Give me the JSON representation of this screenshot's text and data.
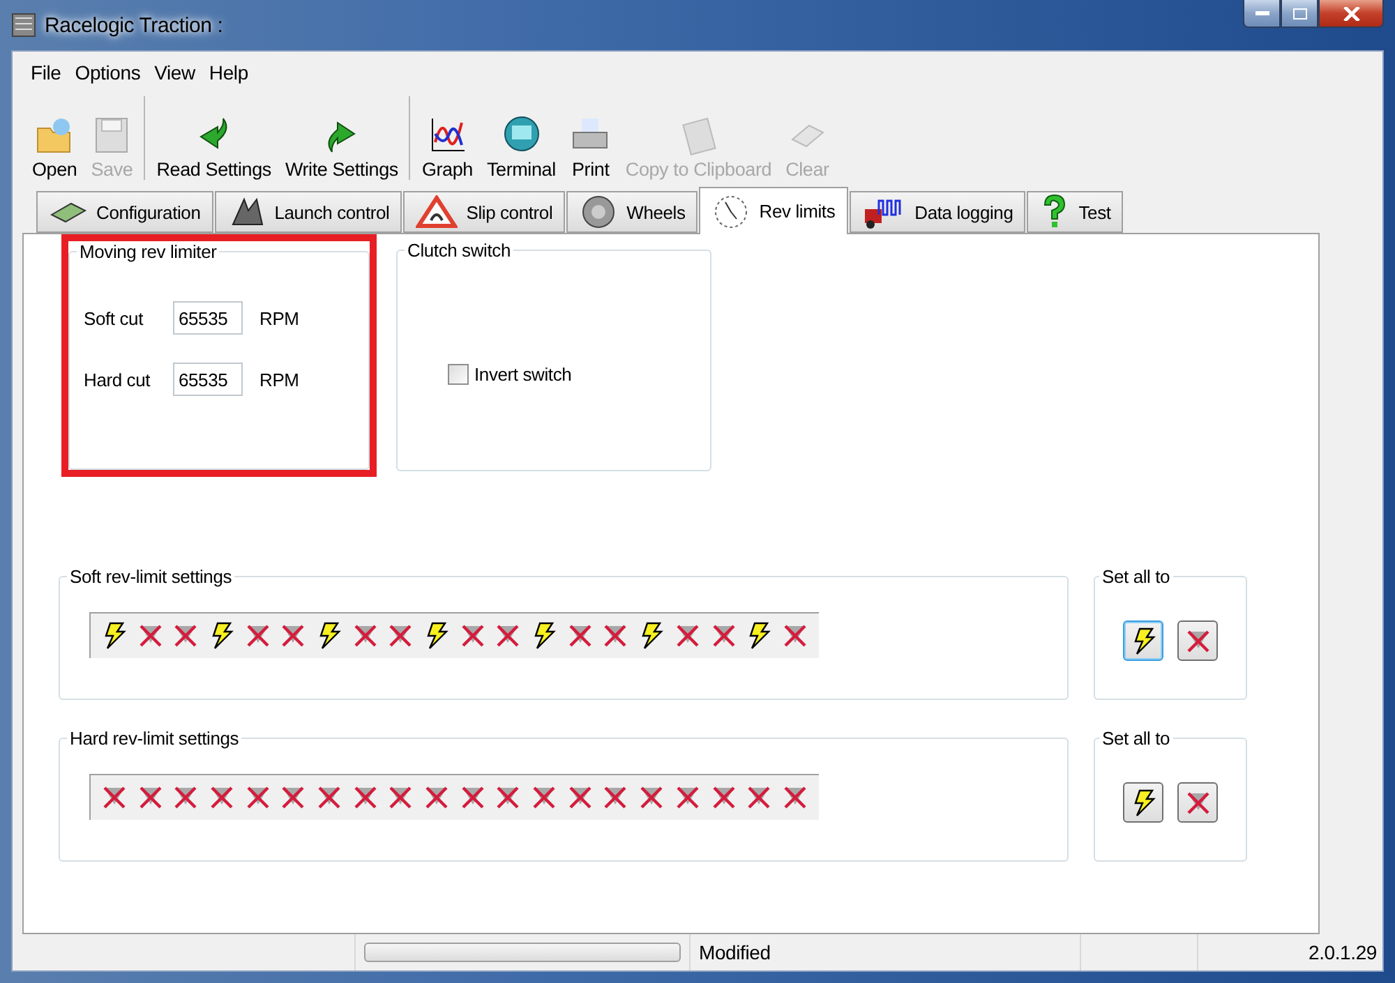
{
  "window": {
    "title": "Racelogic Traction :"
  },
  "menu": [
    "File",
    "Options",
    "View",
    "Help"
  ],
  "toolbar": [
    [
      {
        "kind": "open",
        "label": "Open",
        "disabled": false
      },
      {
        "kind": "save",
        "label": "Save",
        "disabled": true
      }
    ],
    [
      {
        "kind": "read",
        "label": "Read Settings",
        "disabled": false
      },
      {
        "kind": "write",
        "label": "Write Settings",
        "disabled": false
      }
    ],
    [
      {
        "kind": "graph",
        "label": "Graph",
        "disabled": false
      },
      {
        "kind": "terminal",
        "label": "Terminal",
        "disabled": false
      },
      {
        "kind": "print",
        "label": "Print",
        "disabled": false
      },
      {
        "kind": "clipboard",
        "label": "Copy to Clipboard",
        "disabled": true
      },
      {
        "kind": "clear",
        "label": "Clear",
        "disabled": true
      }
    ]
  ],
  "tabs": [
    {
      "kind": "config",
      "label": "Configuration",
      "selected": false
    },
    {
      "kind": "launch",
      "label": "Launch control",
      "selected": false
    },
    {
      "kind": "slip",
      "label": "Slip control",
      "selected": false
    },
    {
      "kind": "wheels",
      "label": "Wheels",
      "selected": false
    },
    {
      "kind": "rev",
      "label": "Rev limits",
      "selected": true
    },
    {
      "kind": "logging",
      "label": "Data logging",
      "selected": false
    },
    {
      "kind": "test",
      "label": "Test",
      "selected": false
    }
  ],
  "moving_rev_limiter": {
    "title": "Moving rev limiter",
    "highlighted": true,
    "fields": [
      {
        "label": "Soft cut",
        "value": "65535",
        "unit": "RPM"
      },
      {
        "label": "Hard cut",
        "value": "65535",
        "unit": "RPM"
      }
    ]
  },
  "clutch_switch": {
    "title": "Clutch switch",
    "checkbox": {
      "label": "Invert switch",
      "checked": false
    }
  },
  "limit_groups": [
    {
      "title": "Soft rev-limit settings",
      "cylinders": [
        {
          "on": true
        },
        {
          "on": false
        },
        {
          "on": false
        },
        {
          "on": true
        },
        {
          "on": false
        },
        {
          "on": false
        },
        {
          "on": true
        },
        {
          "on": false
        },
        {
          "on": false
        },
        {
          "on": true
        },
        {
          "on": false
        },
        {
          "on": false
        },
        {
          "on": true
        },
        {
          "on": false
        },
        {
          "on": false
        },
        {
          "on": true
        },
        {
          "on": false
        },
        {
          "on": false
        },
        {
          "on": true
        },
        {
          "on": false
        }
      ],
      "set_all": {
        "title": "Set all to",
        "buttons": [
          {
            "kind": "on",
            "focused": true
          },
          {
            "kind": "off",
            "focused": false
          }
        ]
      }
    },
    {
      "title": "Hard rev-limit settings",
      "cylinders": [
        {
          "on": false
        },
        {
          "on": false
        },
        {
          "on": false
        },
        {
          "on": false
        },
        {
          "on": false
        },
        {
          "on": false
        },
        {
          "on": false
        },
        {
          "on": false
        },
        {
          "on": false
        },
        {
          "on": false
        },
        {
          "on": false
        },
        {
          "on": false
        },
        {
          "on": false
        },
        {
          "on": false
        },
        {
          "on": false
        },
        {
          "on": false
        },
        {
          "on": false
        },
        {
          "on": false
        },
        {
          "on": false
        },
        {
          "on": false
        }
      ],
      "set_all": {
        "title": "Set all to",
        "buttons": [
          {
            "kind": "on",
            "focused": false
          },
          {
            "kind": "off",
            "focused": false
          }
        ]
      }
    }
  ],
  "status_bar": {
    "progress": {
      "level": 0
    },
    "text": "Modified",
    "version": "2.0.1.29"
  }
}
